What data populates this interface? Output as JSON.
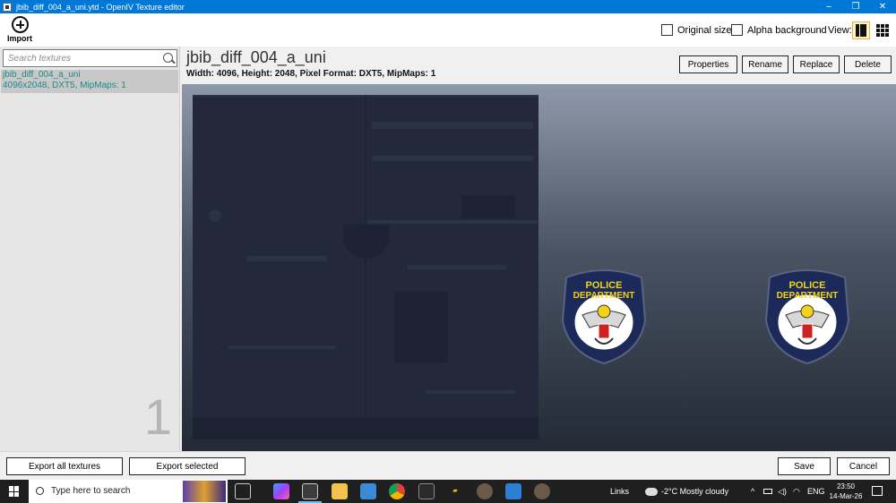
{
  "window": {
    "title": "jbib_diff_004_a_uni.ytd - OpenIV Texture editor",
    "controls": [
      "–",
      "❐",
      "✕"
    ]
  },
  "toolbar": {
    "import_label": "Import",
    "original_size_label": "Original size",
    "alpha_background_label": "Alpha background",
    "view_label": "View:"
  },
  "sidebar": {
    "search_placeholder": "Search textures",
    "items": [
      {
        "name": "jbib_diff_004_a_uni",
        "meta": "4096x2048, DXT5, MipMaps: 1"
      }
    ],
    "count": "1"
  },
  "header": {
    "texture_name": "jbib_diff_004_a_uni",
    "texture_info": "Width: 4096, Height: 2048, Pixel Format: DXT5, MipMaps: 1",
    "buttons": {
      "properties": "Properties",
      "rename": "Rename",
      "replace": "Replace",
      "delete": "Delete"
    }
  },
  "preview": {
    "badge_line1": "POLICE",
    "badge_line2": "DEPARTMENT"
  },
  "footer": {
    "export_all": "Export all textures",
    "export_selected": "Export selected",
    "save": "Save",
    "cancel": "Cancel"
  },
  "taskbar": {
    "search_text": "Type here to search",
    "links_label": "Links",
    "weather": "-2°C  Mostly cloudy",
    "language": "ENG",
    "time": "23:50",
    "date": "14-Mar-26"
  },
  "colors": {
    "titlebar": "#0078d7",
    "selected_item_text": "#1a8a8a",
    "badge_navy": "#1c2a5a",
    "badge_yellow": "#f2d31a"
  }
}
